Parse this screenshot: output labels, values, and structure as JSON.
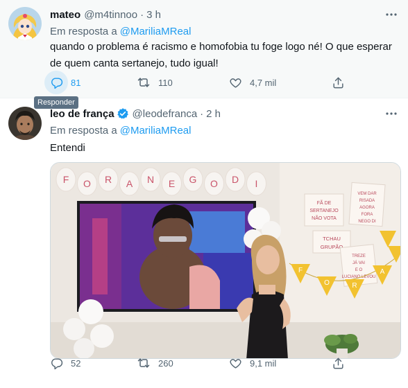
{
  "tweets": [
    {
      "name": "mateo",
      "handle": "@m4tinnoo",
      "dot": "·",
      "time": "3 h",
      "reply_prefix": "Em resposta a",
      "reply_mention": "@MariliaMReal",
      "text_line1": "quando o problema é racismo e homofobia tu foge logo né! O que esperar",
      "text_line2": "de quem canta sertanejo, tudo igual!",
      "reply_count": "81",
      "retweet_count": "110",
      "like_count": "4,7 mil"
    },
    {
      "name": "leo de frança",
      "handle": "@leodefranca",
      "dot": "·",
      "time": "2 h",
      "reply_prefix": "Em resposta a",
      "reply_mention": "@MariliaMReal",
      "text_line1": "Entendi",
      "reply_count": "52",
      "retweet_count": "260",
      "like_count": "9,1 mil"
    }
  ],
  "tooltip": "Responder",
  "photo": {
    "balloon_letters": [
      "F",
      "O",
      "R",
      "A",
      "N",
      "E",
      "G",
      "O",
      "D",
      "I"
    ],
    "sign1": "FÃ DE SERTANEJO NÃO VOTA",
    "sign2": "VEM DAR RISADA AGORA FORA NEGO DI",
    "sign3": "TCHAU GRUPÃO",
    "sign4": "TREZE JÁ VAI E O LUCIANO LEVOU",
    "bunting": [
      "F",
      "O",
      "R",
      "A"
    ]
  },
  "colors": {
    "accent": "#1d9bf0",
    "muted": "#536471",
    "text": "#0f1419"
  },
  "icons": [
    "reply-icon",
    "retweet-icon",
    "like-icon",
    "share-icon",
    "more-icon",
    "verified-icon"
  ]
}
